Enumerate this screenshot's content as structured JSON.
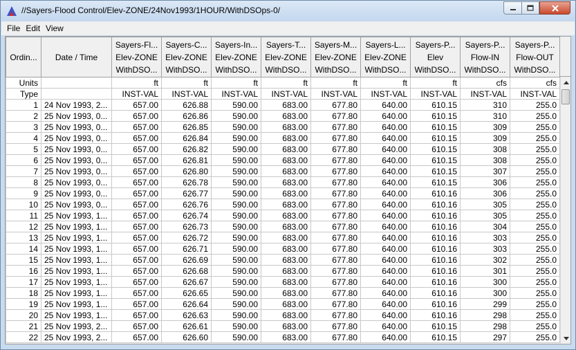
{
  "window": {
    "title": "//Sayers-Flood Control/Elev-ZONE/24Nov1993/1HOUR/WithDSOps-0/",
    "icons": {
      "app": "app-logo-icon",
      "minimize": "minimize-icon",
      "maximize": "maximize-icon",
      "close": "close-icon"
    }
  },
  "menu": [
    "File",
    "Edit",
    "View"
  ],
  "table": {
    "ordinal_header": "Ordin...",
    "date_header": "Date / Time",
    "units_label": "Units",
    "type_label": "Type",
    "columns": [
      {
        "l1": "Sayers-Fl...",
        "l2": "Elev-ZONE",
        "l3": "WithDSO...",
        "units": "ft",
        "type": "INST-VAL"
      },
      {
        "l1": "Sayers-C...",
        "l2": "Elev-ZONE",
        "l3": "WithDSO...",
        "units": "ft",
        "type": "INST-VAL"
      },
      {
        "l1": "Sayers-In...",
        "l2": "Elev-ZONE",
        "l3": "WithDSO...",
        "units": "ft",
        "type": "INST-VAL"
      },
      {
        "l1": "Sayers-T...",
        "l2": "Elev-ZONE",
        "l3": "WithDSO...",
        "units": "ft",
        "type": "INST-VAL"
      },
      {
        "l1": "Sayers-M...",
        "l2": "Elev-ZONE",
        "l3": "WithDSO...",
        "units": "ft",
        "type": "INST-VAL"
      },
      {
        "l1": "Sayers-L...",
        "l2": "Elev-ZONE",
        "l3": "WithDSO...",
        "units": "ft",
        "type": "INST-VAL"
      },
      {
        "l1": "Sayers-P...",
        "l2": "Elev",
        "l3": "WithDSO...",
        "units": "ft",
        "type": "INST-VAL"
      },
      {
        "l1": "Sayers-P...",
        "l2": "Flow-IN",
        "l3": "WithDSO...",
        "units": "cfs",
        "type": "INST-VAL"
      },
      {
        "l1": "Sayers-P...",
        "l2": "Flow-OUT",
        "l3": "WithDSO...",
        "units": "cfs",
        "type": "INST-VAL"
      }
    ],
    "rows": [
      {
        "n": "1",
        "date": "24 Nov 1993, 2...",
        "v": [
          "657.00",
          "626.88",
          "590.00",
          "683.00",
          "677.80",
          "640.00",
          "610.15",
          "310",
          "255.0"
        ]
      },
      {
        "n": "2",
        "date": "25 Nov 1993, 0...",
        "v": [
          "657.00",
          "626.86",
          "590.00",
          "683.00",
          "677.80",
          "640.00",
          "610.15",
          "310",
          "255.0"
        ]
      },
      {
        "n": "3",
        "date": "25 Nov 1993, 0...",
        "v": [
          "657.00",
          "626.85",
          "590.00",
          "683.00",
          "677.80",
          "640.00",
          "610.15",
          "309",
          "255.0"
        ]
      },
      {
        "n": "4",
        "date": "25 Nov 1993, 0...",
        "v": [
          "657.00",
          "626.84",
          "590.00",
          "683.00",
          "677.80",
          "640.00",
          "610.15",
          "309",
          "255.0"
        ]
      },
      {
        "n": "5",
        "date": "25 Nov 1993, 0...",
        "v": [
          "657.00",
          "626.82",
          "590.00",
          "683.00",
          "677.80",
          "640.00",
          "610.15",
          "308",
          "255.0"
        ]
      },
      {
        "n": "6",
        "date": "25 Nov 1993, 0...",
        "v": [
          "657.00",
          "626.81",
          "590.00",
          "683.00",
          "677.80",
          "640.00",
          "610.15",
          "308",
          "255.0"
        ]
      },
      {
        "n": "7",
        "date": "25 Nov 1993, 0...",
        "v": [
          "657.00",
          "626.80",
          "590.00",
          "683.00",
          "677.80",
          "640.00",
          "610.15",
          "307",
          "255.0"
        ]
      },
      {
        "n": "8",
        "date": "25 Nov 1993, 0...",
        "v": [
          "657.00",
          "626.78",
          "590.00",
          "683.00",
          "677.80",
          "640.00",
          "610.15",
          "306",
          "255.0"
        ]
      },
      {
        "n": "9",
        "date": "25 Nov 1993, 0...",
        "v": [
          "657.00",
          "626.77",
          "590.00",
          "683.00",
          "677.80",
          "640.00",
          "610.16",
          "306",
          "255.0"
        ]
      },
      {
        "n": "10",
        "date": "25 Nov 1993, 0...",
        "v": [
          "657.00",
          "626.76",
          "590.00",
          "683.00",
          "677.80",
          "640.00",
          "610.16",
          "305",
          "255.0"
        ]
      },
      {
        "n": "11",
        "date": "25 Nov 1993, 1...",
        "v": [
          "657.00",
          "626.74",
          "590.00",
          "683.00",
          "677.80",
          "640.00",
          "610.16",
          "305",
          "255.0"
        ]
      },
      {
        "n": "12",
        "date": "25 Nov 1993, 1...",
        "v": [
          "657.00",
          "626.73",
          "590.00",
          "683.00",
          "677.80",
          "640.00",
          "610.16",
          "304",
          "255.0"
        ]
      },
      {
        "n": "13",
        "date": "25 Nov 1993, 1...",
        "v": [
          "657.00",
          "626.72",
          "590.00",
          "683.00",
          "677.80",
          "640.00",
          "610.16",
          "303",
          "255.0"
        ]
      },
      {
        "n": "14",
        "date": "25 Nov 1993, 1...",
        "v": [
          "657.00",
          "626.71",
          "590.00",
          "683.00",
          "677.80",
          "640.00",
          "610.16",
          "303",
          "255.0"
        ]
      },
      {
        "n": "15",
        "date": "25 Nov 1993, 1...",
        "v": [
          "657.00",
          "626.69",
          "590.00",
          "683.00",
          "677.80",
          "640.00",
          "610.16",
          "302",
          "255.0"
        ]
      },
      {
        "n": "16",
        "date": "25 Nov 1993, 1...",
        "v": [
          "657.00",
          "626.68",
          "590.00",
          "683.00",
          "677.80",
          "640.00",
          "610.16",
          "301",
          "255.0"
        ]
      },
      {
        "n": "17",
        "date": "25 Nov 1993, 1...",
        "v": [
          "657.00",
          "626.67",
          "590.00",
          "683.00",
          "677.80",
          "640.00",
          "610.16",
          "300",
          "255.0"
        ]
      },
      {
        "n": "18",
        "date": "25 Nov 1993, 1...",
        "v": [
          "657.00",
          "626.65",
          "590.00",
          "683.00",
          "677.80",
          "640.00",
          "610.16",
          "300",
          "255.0"
        ]
      },
      {
        "n": "19",
        "date": "25 Nov 1993, 1...",
        "v": [
          "657.00",
          "626.64",
          "590.00",
          "683.00",
          "677.80",
          "640.00",
          "610.16",
          "299",
          "255.0"
        ]
      },
      {
        "n": "20",
        "date": "25 Nov 1993, 1...",
        "v": [
          "657.00",
          "626.63",
          "590.00",
          "683.00",
          "677.80",
          "640.00",
          "610.16",
          "298",
          "255.0"
        ]
      },
      {
        "n": "21",
        "date": "25 Nov 1993, 2...",
        "v": [
          "657.00",
          "626.61",
          "590.00",
          "683.00",
          "677.80",
          "640.00",
          "610.15",
          "298",
          "255.0"
        ]
      },
      {
        "n": "22",
        "date": "25 Nov 1993, 2...",
        "v": [
          "657.00",
          "626.60",
          "590.00",
          "683.00",
          "677.80",
          "640.00",
          "610.15",
          "297",
          "255.0"
        ]
      }
    ]
  },
  "scrollbar": {
    "up": "scroll-up-arrow-icon",
    "down": "scroll-down-arrow-icon"
  }
}
